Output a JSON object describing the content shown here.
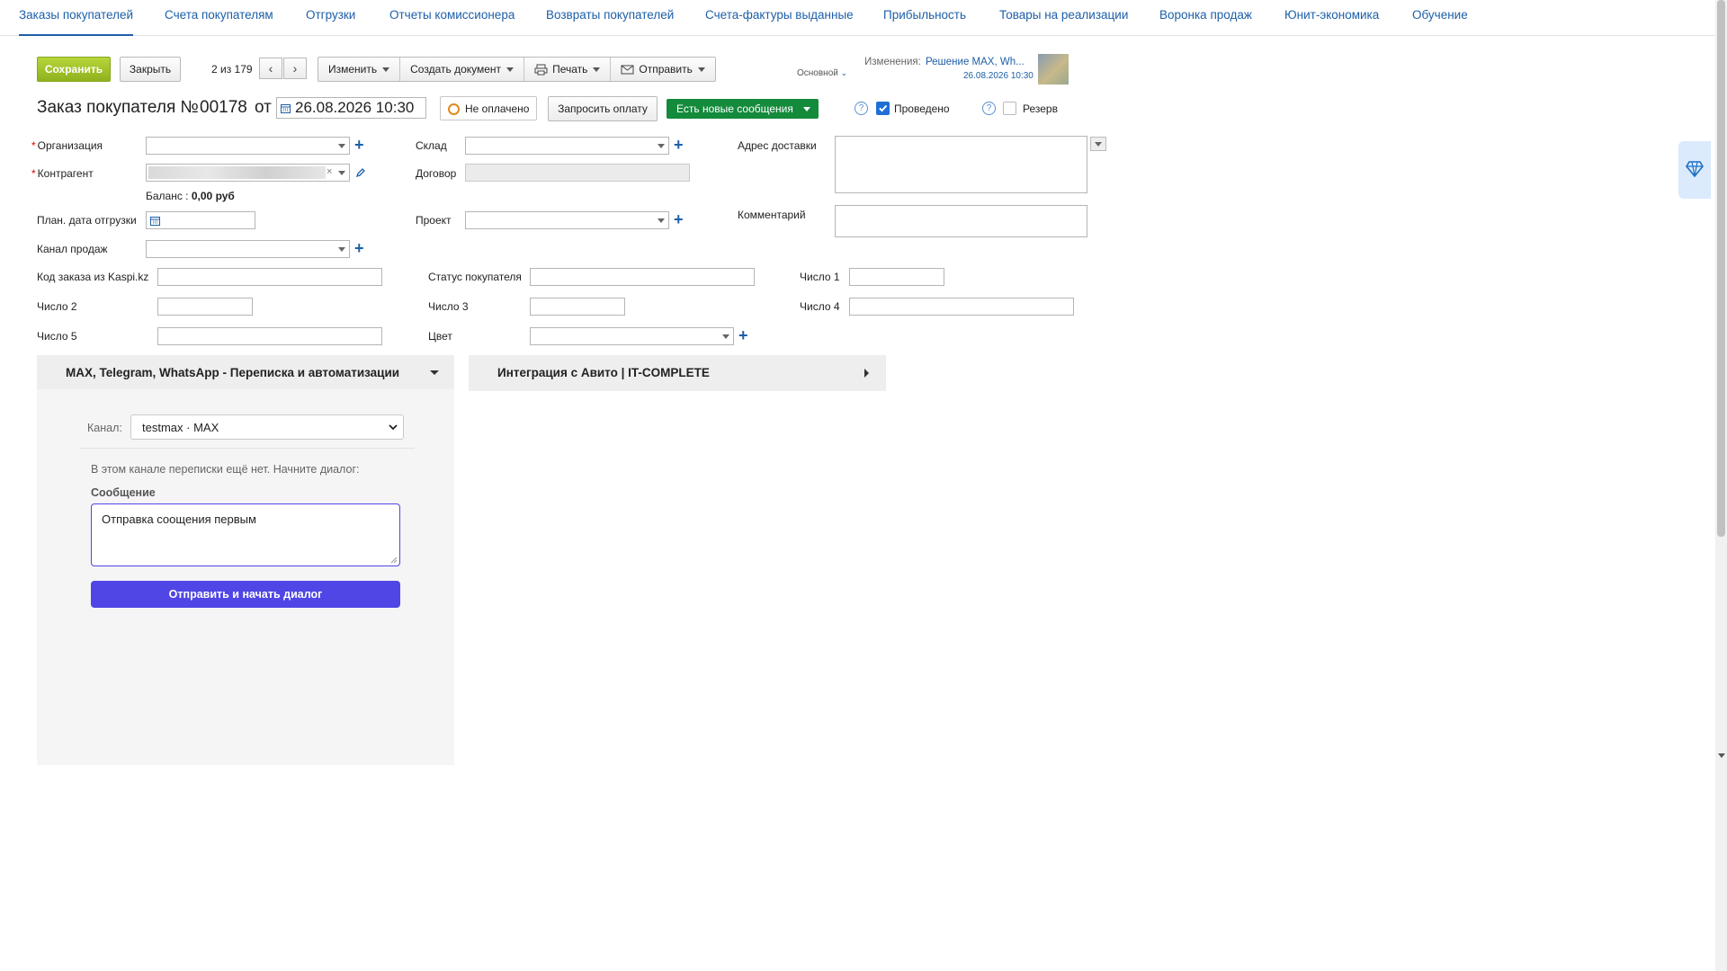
{
  "nav": {
    "tabs": [
      {
        "label": "Заказы покупателей",
        "active": true
      },
      {
        "label": "Счета покупателям"
      },
      {
        "label": "Отгрузки"
      },
      {
        "label": "Отчеты комиссионера"
      },
      {
        "label": "Возвраты покупателей"
      },
      {
        "label": "Счета-фактуры выданные"
      },
      {
        "label": "Прибыльность"
      },
      {
        "label": "Товары на реализации"
      },
      {
        "label": "Воронка продаж"
      },
      {
        "label": "Юнит-экономика"
      },
      {
        "label": "Обучение"
      }
    ]
  },
  "toolbar": {
    "save": "Сохранить",
    "close": "Закрыть",
    "pager": "2 из 179",
    "change": "Изменить",
    "create_doc": "Создать документ",
    "print": "Печать",
    "send": "Отправить",
    "base": "Основной",
    "changes_label": "Изменения:",
    "changes_link": "Решение MAX, Wh...",
    "changes_date": "26.08.2026 10:30"
  },
  "header": {
    "title": "Заказ покупателя №",
    "number": "00178",
    "from": "от",
    "datetime": "26.08.2026 10:30",
    "payment_status": "Не оплачено",
    "request_payment": "Запросить оплату",
    "new_messages": "Есть новые сообщения",
    "posted": "Проведено",
    "reserve": "Резерв",
    "help": "?"
  },
  "form": {
    "organization": "Организация",
    "counterparty": "Контрагент",
    "balance_label": "Баланс :",
    "balance_value": "0,00 руб",
    "plan_date": "План. дата отгрузки",
    "sales_channel": "Канал продаж",
    "warehouse": "Склад",
    "contract": "Договор",
    "project": "Проект",
    "delivery_address": "Адрес доставки",
    "comment": "Комментарий",
    "kaspi_code": "Код заказа из Kaspi.kz",
    "buyer_status": "Статус покупателя",
    "num1": "Число 1",
    "num2": "Число 2",
    "num3": "Число 3",
    "num4": "Число 4",
    "num5": "Число 5",
    "color": "Цвет"
  },
  "messenger": {
    "title": "MAX, Telegram, WhatsApp - Переписка и автоматизации",
    "channel_label": "Канал:",
    "channel_value": "testmax · MAX",
    "empty_text": "В этом канале переписки ещё нет. Начните диалог:",
    "message_label": "Сообщение",
    "message_value": "Отправка соощения первым",
    "send_button": "Отправить и начать диалог",
    "button_color": "#4f46e5"
  },
  "avito": {
    "title": "Интеграция с Авито | IT-COMPLETE"
  },
  "colors": {
    "link": "#1d5fa8",
    "save_green": "#8fb21d",
    "new_msg_green": "#148a3b",
    "posted_blue": "#1f6fd6"
  }
}
